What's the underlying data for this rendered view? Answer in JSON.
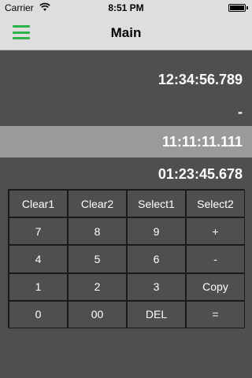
{
  "status_bar": {
    "carrier": "Carrier",
    "time": "8:51 PM",
    "wifi_icon": "wifi-icon",
    "battery_icon": "battery-icon"
  },
  "nav_bar": {
    "title": "Main",
    "menu_icon": "hamburger-menu-icon",
    "accent_color": "#2db34a"
  },
  "display": {
    "line1": "12:34:56.789",
    "line2": "-",
    "line3": "11:11:11.111",
    "line4": "01:23:45.678"
  },
  "keypad": {
    "clear1": "Clear1",
    "clear2": "Clear2",
    "select1": "Select1",
    "select2": "Select2",
    "k7": "7",
    "k8": "8",
    "k9": "9",
    "plus": "+",
    "k4": "4",
    "k5": "5",
    "k6": "6",
    "minus": "-",
    "k1": "1",
    "k2": "2",
    "k3": "3",
    "copy": "Copy",
    "k0": "0",
    "k00": "00",
    "del": "DEL",
    "equals": "="
  },
  "colors": {
    "background": "#4f4f4f",
    "highlight_row": "#9a9a9a",
    "bar": "#dedede"
  }
}
